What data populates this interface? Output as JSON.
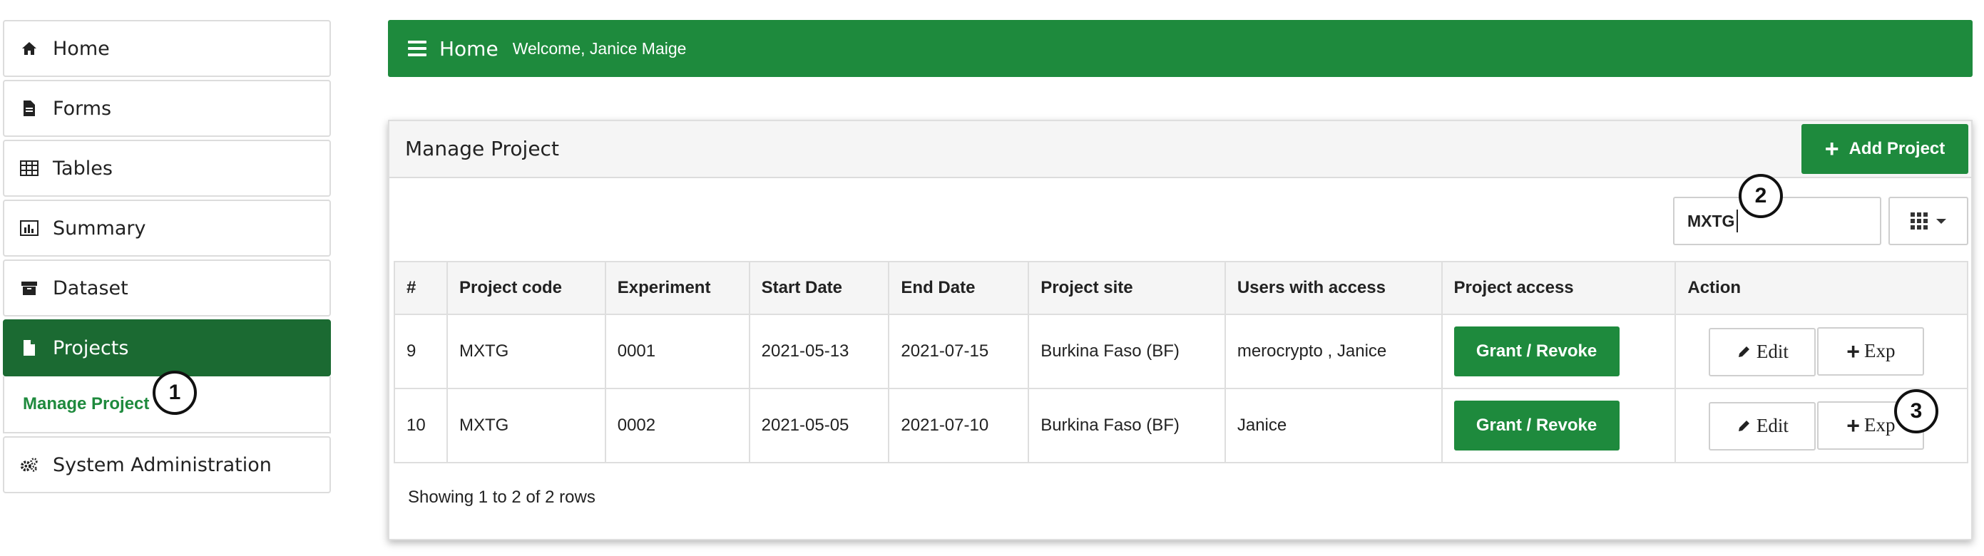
{
  "sidebar": {
    "items": [
      {
        "label": "Home",
        "icon": "home-icon"
      },
      {
        "label": "Forms",
        "icon": "file-icon"
      },
      {
        "label": "Tables",
        "icon": "table-icon"
      },
      {
        "label": "Summary",
        "icon": "bar-chart-icon"
      },
      {
        "label": "Dataset",
        "icon": "archive-icon"
      },
      {
        "label": "Projects",
        "icon": "file-icon"
      },
      {
        "label": "Manage Project"
      },
      {
        "label": "System Administration",
        "icon": "gears-icon"
      }
    ]
  },
  "header": {
    "title": "Home",
    "welcome": "Welcome, Janice Maige"
  },
  "panel": {
    "title": "Manage Project",
    "add_label": "Add Project"
  },
  "search": {
    "value": "MXTG"
  },
  "table": {
    "headers": [
      "#",
      "Project code",
      "Experiment",
      "Start Date",
      "End Date",
      "Project site",
      "Users with access",
      "Project access",
      "Action"
    ],
    "rows": [
      [
        "9",
        "MXTG",
        "0001",
        "2021-05-13",
        "2021-07-15",
        "Burkina Faso (BF)",
        "merocrypto , Janice"
      ],
      [
        "10",
        "MXTG",
        "0002",
        "2021-05-05",
        "2021-07-10",
        "Burkina Faso (BF)",
        "Janice"
      ]
    ],
    "grant_label": "Grant / Revoke",
    "edit_label": "Edit",
    "exp_label": "Exp"
  },
  "footer": {
    "showing": "Showing 1 to 2 of 2 rows"
  },
  "annotations": [
    "1",
    "2",
    "3"
  ],
  "colors": {
    "primary_green": "#1e8a3d",
    "active_green": "#1b6a32"
  }
}
